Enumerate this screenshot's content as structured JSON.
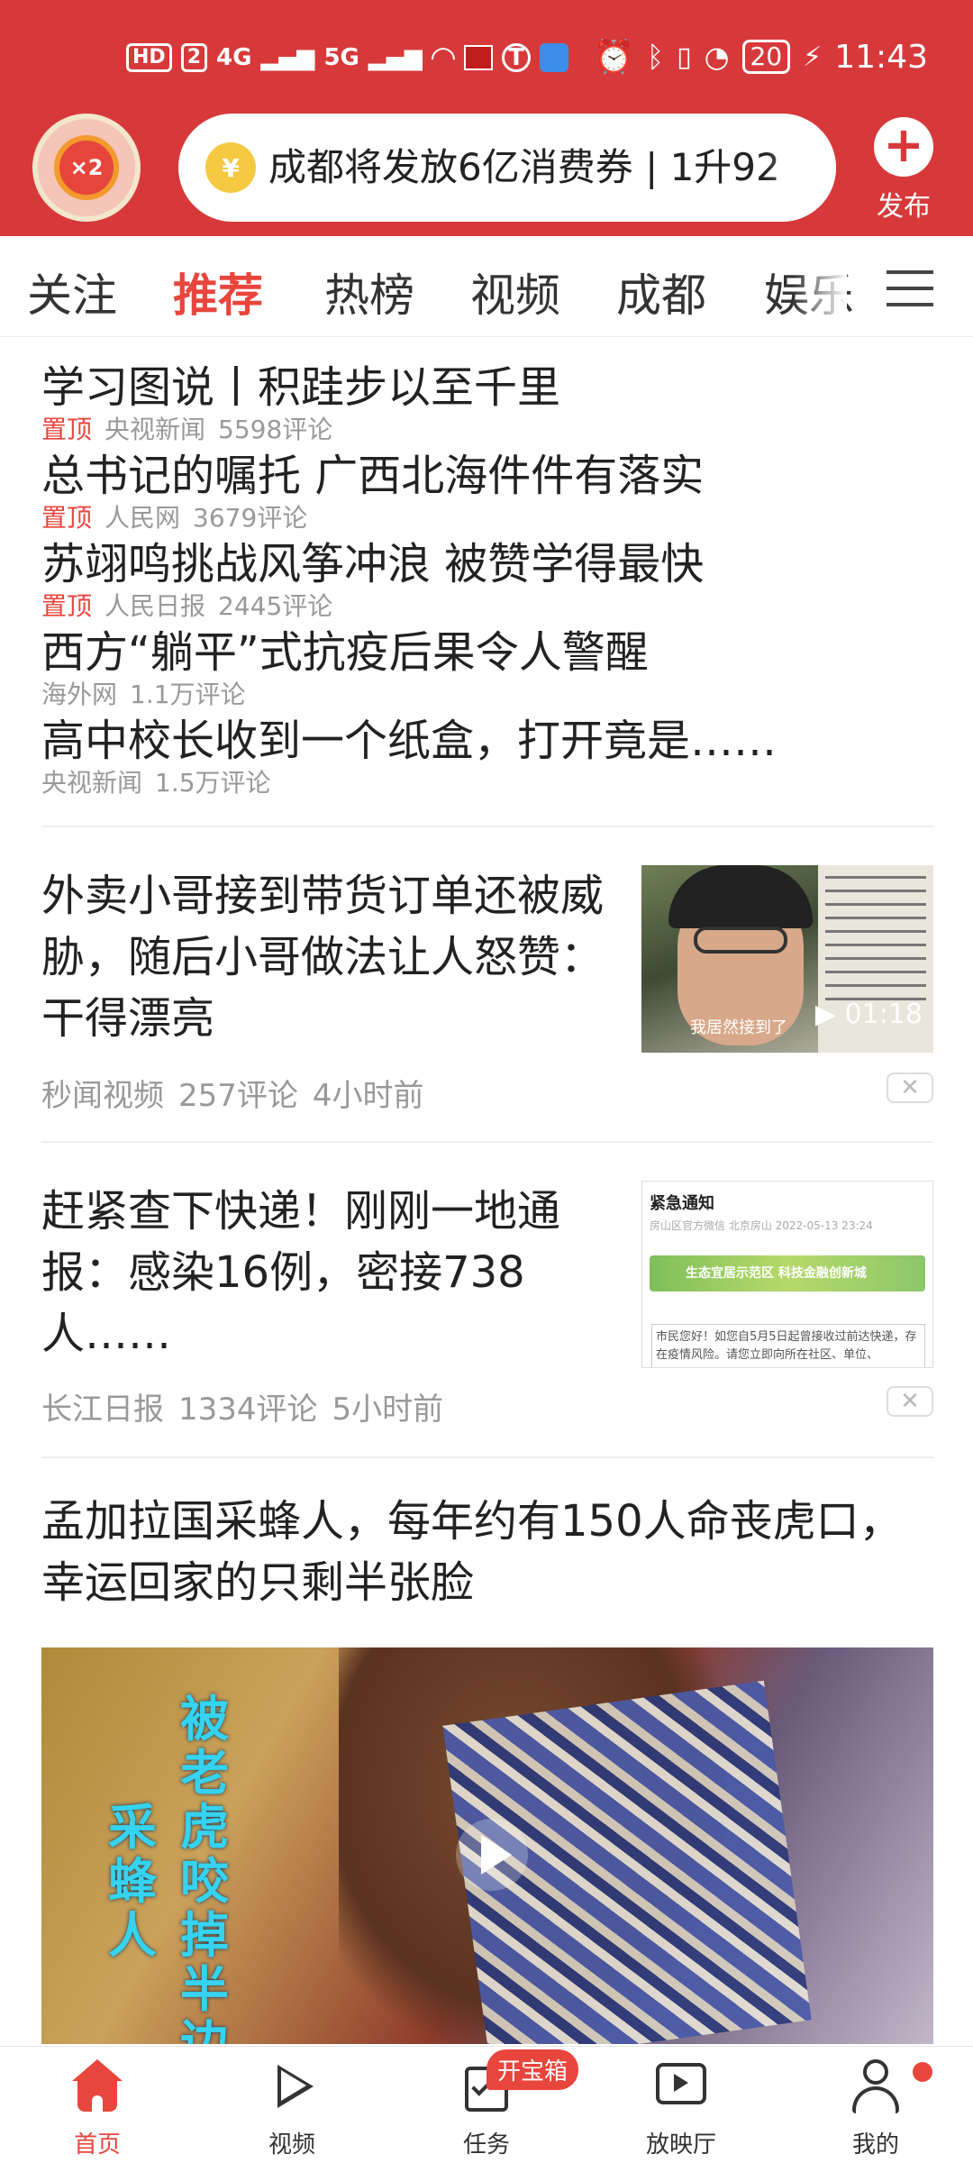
{
  "status_bar": {
    "left_labels": [
      "HD",
      "2",
      "4G",
      "5G"
    ],
    "battery": "20",
    "time": "11:43"
  },
  "header": {
    "avatar_badge": "×2",
    "search_coin": "¥",
    "search_text": "成都将发放6亿消费券 | 1升92",
    "publish_label": "发布"
  },
  "tabs": [
    "关注",
    "推荐",
    "热榜",
    "视频",
    "成都",
    "娱乐"
  ],
  "active_tab": "推荐",
  "top_news": [
    {
      "title": "学习图说丨积跬步以至千里",
      "pin": "置顶",
      "source": "央视新闻",
      "comments": "5598评论"
    },
    {
      "title": "总书记的嘱托 广西北海件件有落实",
      "pin": "置顶",
      "source": "人民网",
      "comments": "3679评论"
    },
    {
      "title": "苏翊鸣挑战风筝冲浪 被赞学得最快",
      "pin": "置顶",
      "source": "人民日报",
      "comments": "2445评论"
    },
    {
      "title": "西方“躺平”式抗疫后果令人警醒",
      "pin": "",
      "source": "海外网",
      "comments": "1.1万评论"
    },
    {
      "title": "高中校长收到一个纸盒，打开竟是……",
      "pin": "",
      "source": "央视新闻",
      "comments": "1.5万评论"
    }
  ],
  "articles": [
    {
      "title": "外卖小哥接到带货订单还被威胁，随后小哥做法让人怒赞：干得漂亮",
      "source": "秒闻视频",
      "comments": "257评论",
      "time": "4小时前",
      "thumb_caption": "我居然接到了",
      "duration": "01:18"
    },
    {
      "title": "赶紧查下快递！刚刚一地通报：感染16例，密接738人……",
      "source": "长江日报",
      "comments": "1334评论",
      "time": "5小时前",
      "thumb_title": "紧急通知",
      "thumb_sub": "房山区官方微信  北京房山  2022-05-13 23:24",
      "thumb_banner": "生态宜居示范区 科技金融创新城",
      "thumb_text": "市民您好！如您自5月5日起曾接收过前达快递，存在疫情风险。请您立即向所在社区、单位、"
    }
  ],
  "video_article": {
    "title": "孟加拉国采蜂人，每年约有150人命丧虎口，幸运回家的只剩半张脸",
    "overlay_left": "采蜂人",
    "overlay_right": "被老虎咬掉半边"
  },
  "bottom_nav": [
    {
      "label": "首页",
      "icon": "home-icon"
    },
    {
      "label": "视频",
      "icon": "video-play-icon"
    },
    {
      "label": "任务",
      "icon": "task-icon"
    },
    {
      "label": "放映厅",
      "icon": "theater-icon"
    },
    {
      "label": "我的",
      "icon": "profile-icon"
    }
  ],
  "task_badge": "开宝箱",
  "colors": {
    "brand_red": "#d7393b",
    "accent_red": "#e8453c"
  }
}
